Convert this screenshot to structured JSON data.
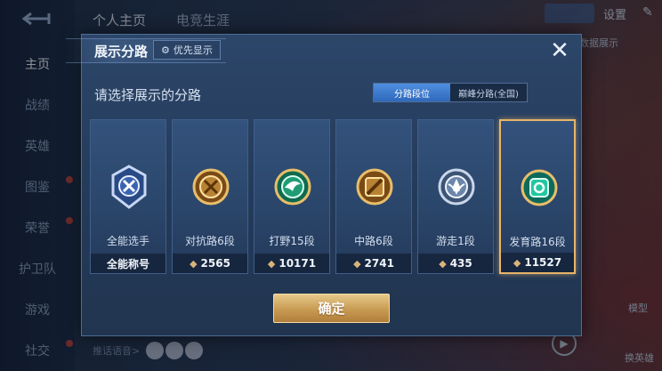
{
  "background": {
    "back_icon": "back-arrow-icon",
    "sidebar": [
      {
        "label": "主页",
        "active": true
      },
      {
        "label": "战绩",
        "active": false
      },
      {
        "label": "英雄",
        "active": false
      },
      {
        "label": "图鉴",
        "active": false,
        "dot": true
      },
      {
        "label": "荣誉",
        "active": false,
        "dot": true
      },
      {
        "label": "护卫队",
        "active": false
      },
      {
        "label": "游戏",
        "active": false
      },
      {
        "label": "社交",
        "active": false,
        "dot": true
      }
    ],
    "top_tabs": [
      {
        "label": "个人主页",
        "active": true
      },
      {
        "label": "电竞生涯",
        "active": false
      }
    ],
    "settings_label": "设置",
    "side_text": "和数据展示",
    "bottom_text": "推话语音>",
    "right_label_1": "模型",
    "right_label_2": "换英雄"
  },
  "modal": {
    "title": "展示分路",
    "priority_label": "优先显示",
    "priority_icon": "gear-icon",
    "close_icon": "close-icon",
    "subtitle": "请选择展示的分路",
    "toggle": [
      {
        "label": "分路段位",
        "active": true
      },
      {
        "label": "巅峰分路(全国)",
        "active": false
      }
    ],
    "cards": [
      {
        "name": "全能选手",
        "footer": "全能称号",
        "coin": false,
        "selected": false,
        "badge": "all-round",
        "color": "#8fb0e8"
      },
      {
        "name": "对抗路6段",
        "footer": "2565",
        "coin": true,
        "selected": false,
        "badge": "clash-lane",
        "color": "#d8a24a"
      },
      {
        "name": "打野15段",
        "footer": "10171",
        "coin": true,
        "selected": false,
        "badge": "jungle",
        "color": "#3fb58a"
      },
      {
        "name": "中路6段",
        "footer": "2741",
        "coin": true,
        "selected": false,
        "badge": "mid-lane",
        "color": "#d8a24a"
      },
      {
        "name": "游走1段",
        "footer": "435",
        "coin": true,
        "selected": false,
        "badge": "roam",
        "color": "#b8c8e0"
      },
      {
        "name": "发育路16段",
        "footer": "11527",
        "coin": true,
        "selected": true,
        "badge": "farm-lane",
        "color": "#34c9a4"
      }
    ],
    "confirm_label": "确定"
  }
}
